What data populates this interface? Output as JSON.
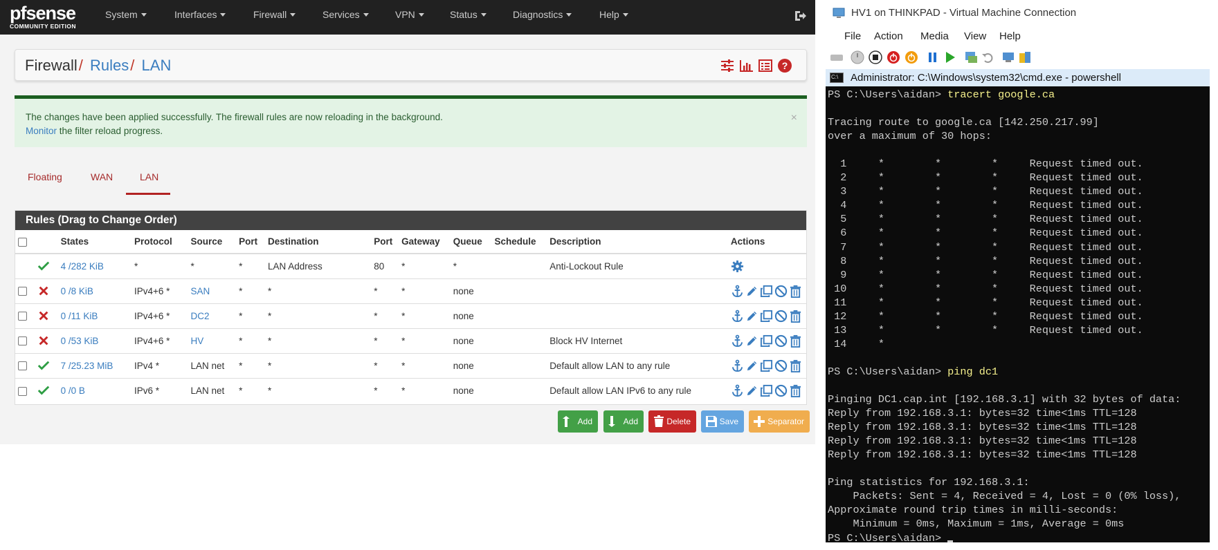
{
  "pfsense": {
    "logo_primary": "pfsense",
    "logo_secondary": "COMMUNITY EDITION",
    "nav": [
      "System",
      "Interfaces",
      "Firewall",
      "Services",
      "VPN",
      "Status",
      "Diagnostics",
      "Help"
    ],
    "breadcrumb": [
      "Firewall",
      "Rules",
      "LAN"
    ],
    "alert": {
      "line1": "The changes have been applied successfully. The firewall rules are now reloading in the background.",
      "link": "Monitor",
      "line2_rest": " the filter reload progress.",
      "close": "×"
    },
    "tabs": [
      "Floating",
      "WAN",
      "LAN"
    ],
    "active_tab": "LAN",
    "panel_title": "Rules (Drag to Change Order)",
    "columns": [
      "States",
      "Protocol",
      "Source",
      "Port",
      "Destination",
      "Port",
      "Gateway",
      "Queue",
      "Schedule",
      "Description",
      "Actions"
    ],
    "rules": [
      {
        "status": "pass",
        "states": "4 /282 KiB",
        "protocol": "*",
        "source": "*",
        "src_port": "*",
        "destination": "LAN Address",
        "dst_port": "80",
        "gateway": "*",
        "queue": "*",
        "schedule": "",
        "description": "Anti-Lockout Rule",
        "locked": true
      },
      {
        "status": "block",
        "states": "0 /8 KiB",
        "protocol": "IPv4+6 *",
        "source": "SAN",
        "src_port": "*",
        "destination": "*",
        "dst_port": "*",
        "gateway": "*",
        "queue": "none",
        "schedule": "",
        "description": ""
      },
      {
        "status": "block",
        "states": "0 /11 KiB",
        "protocol": "IPv4+6 *",
        "source": "DC2",
        "src_port": "*",
        "destination": "*",
        "dst_port": "*",
        "gateway": "*",
        "queue": "none",
        "schedule": "",
        "description": ""
      },
      {
        "status": "block",
        "states": "0 /53 KiB",
        "protocol": "IPv4+6 *",
        "source": "HV",
        "src_port": "*",
        "destination": "*",
        "dst_port": "*",
        "gateway": "*",
        "queue": "none",
        "schedule": "",
        "description": "Block HV Internet"
      },
      {
        "status": "pass",
        "states": "7 /25.23 MiB",
        "protocol": "IPv4 *",
        "source": "LAN net",
        "src_port": "*",
        "destination": "*",
        "dst_port": "*",
        "gateway": "*",
        "queue": "none",
        "schedule": "",
        "description": "Default allow LAN to any rule"
      },
      {
        "status": "pass",
        "states": "0 /0 B",
        "protocol": "IPv6 *",
        "source": "LAN net",
        "src_port": "*",
        "destination": "*",
        "dst_port": "*",
        "gateway": "*",
        "queue": "none",
        "schedule": "",
        "description": "Default allow LAN IPv6 to any rule"
      }
    ],
    "buttons": {
      "add_top": "Add",
      "add_bottom": "Add",
      "delete": "Delete",
      "save": "Save",
      "separator": "Separator"
    },
    "colors": {
      "nav_bg": "#212121",
      "pass": "#2e9e44",
      "block": "#c62828",
      "link": "#3a7dbf",
      "btn_green": "#43a047",
      "btn_red": "#c62828",
      "btn_blue": "#64a5e0",
      "btn_orange": "#f0ad4e"
    }
  },
  "vm": {
    "title": "HV1 on THINKPAD - Virtual Machine Connection",
    "menu": [
      "File",
      "Action",
      "Media",
      "View",
      "Help"
    ],
    "cmd_title": "Administrator: C:\\Windows\\system32\\cmd.exe - powershell",
    "prompt": "PS C:\\Users\\aidan> ",
    "cmd1": "tracert google.ca",
    "trace_header": [
      "Tracing route to google.ca [142.250.217.99]",
      "over a maximum of 30 hops:"
    ],
    "hops": [
      "  1     *        *        *     Request timed out.",
      "  2     *        *        *     Request timed out.",
      "  3     *        *        *     Request timed out.",
      "  4     *        *        *     Request timed out.",
      "  5     *        *        *     Request timed out.",
      "  6     *        *        *     Request timed out.",
      "  7     *        *        *     Request timed out.",
      "  8     *        *        *     Request timed out.",
      "  9     *        *        *     Request timed out.",
      " 10     *        *        *     Request timed out.",
      " 11     *        *        *     Request timed out.",
      " 12     *        *        *     Request timed out.",
      " 13     *        *        *     Request timed out.",
      " 14     *"
    ],
    "cmd2": "ping dc1",
    "ping_header": "Pinging DC1.cap.int [192.168.3.1] with 32 bytes of data:",
    "replies": [
      "Reply from 192.168.3.1: bytes=32 time<1ms TTL=128",
      "Reply from 192.168.3.1: bytes=32 time<1ms TTL=128",
      "Reply from 192.168.3.1: bytes=32 time<1ms TTL=128",
      "Reply from 192.168.3.1: bytes=32 time<1ms TTL=128"
    ],
    "stats": [
      "Ping statistics for 192.168.3.1:",
      "    Packets: Sent = 4, Received = 4, Lost = 0 (0% loss),",
      "Approximate round trip times in milli-seconds:",
      "    Minimum = 0ms, Maximum = 1ms, Average = 0ms"
    ]
  }
}
